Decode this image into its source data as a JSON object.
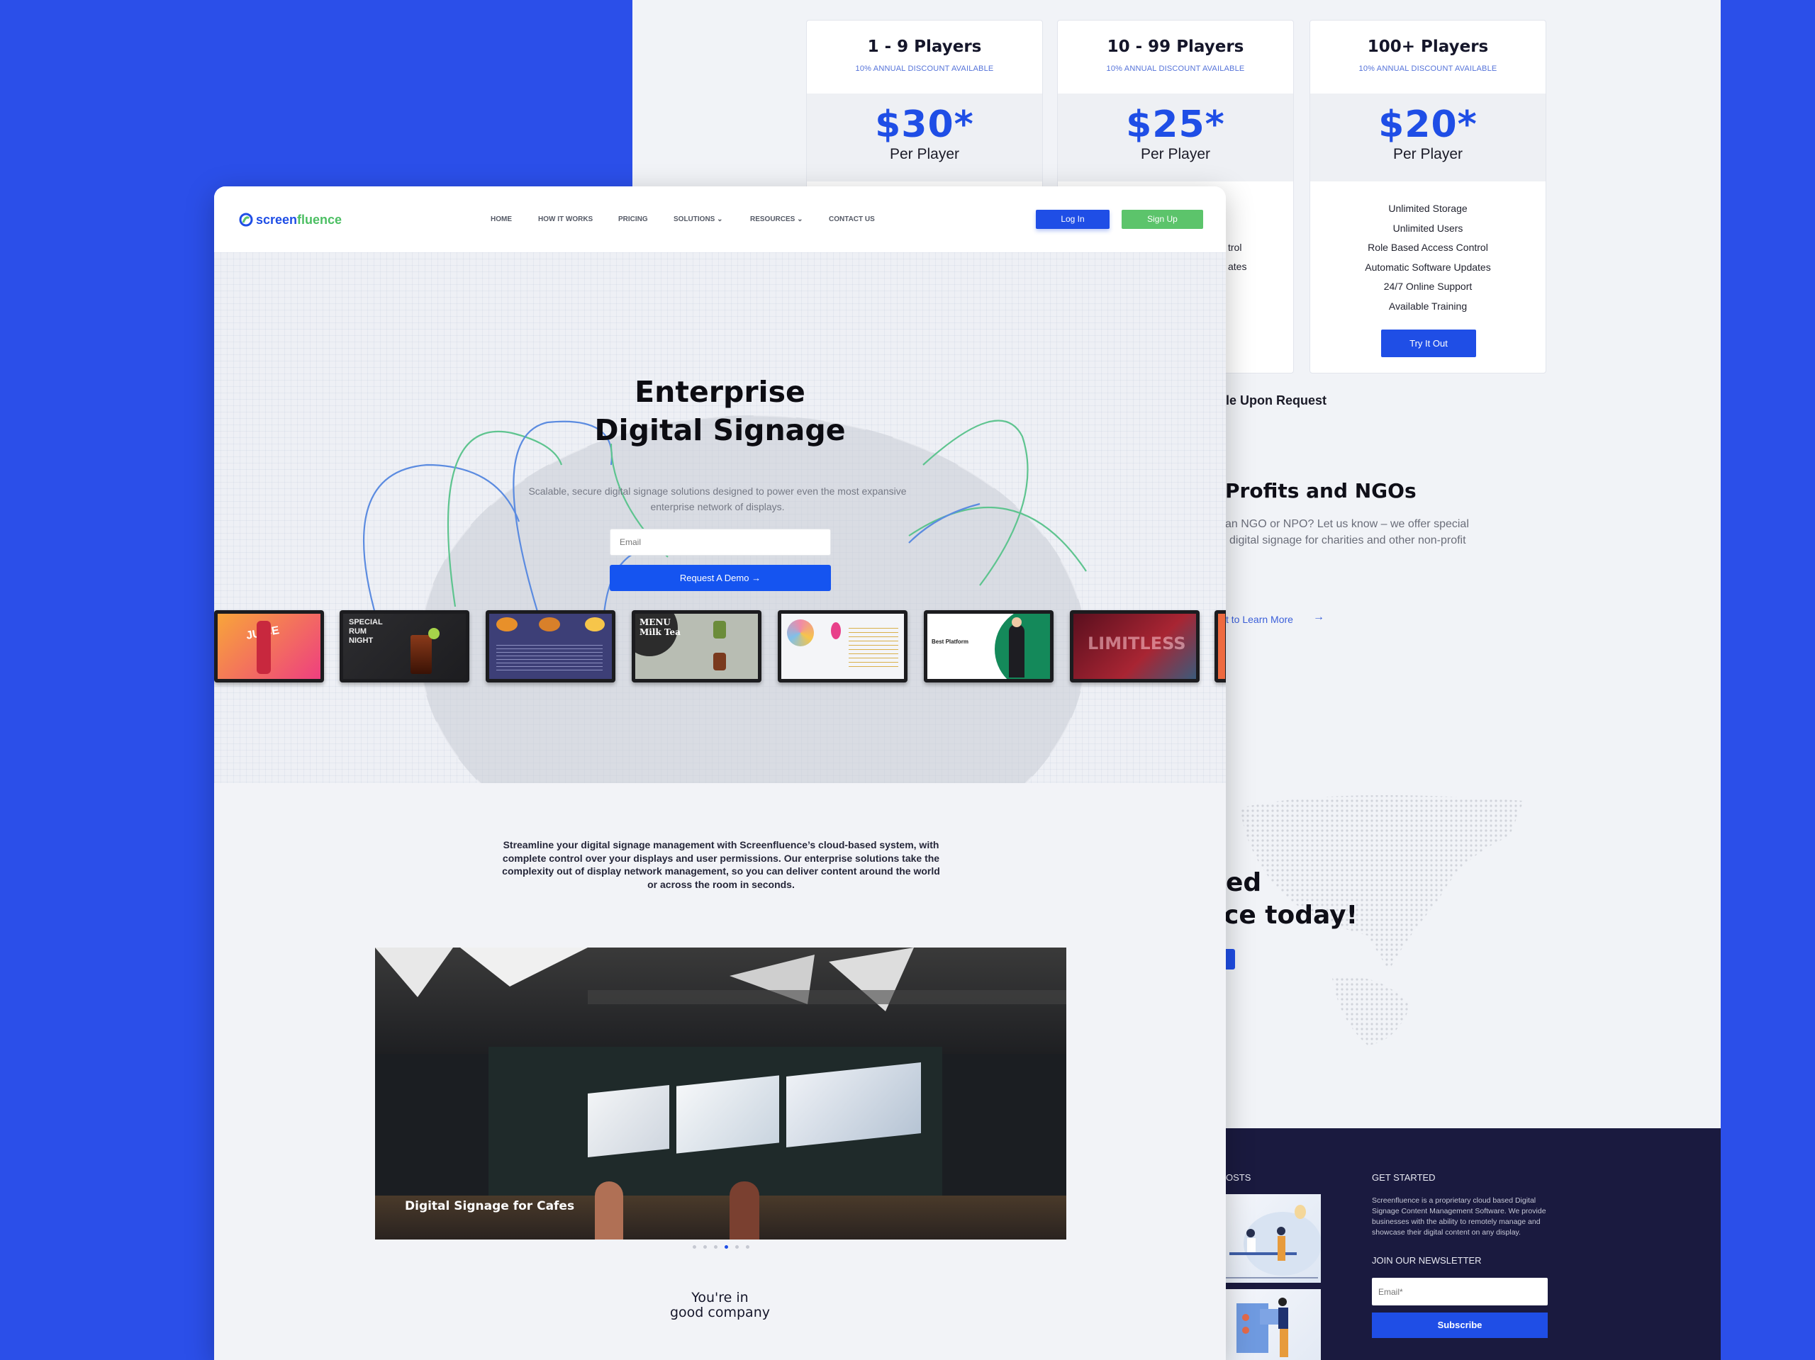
{
  "colors": {
    "brand_blue": "#1f4ee6",
    "brand_green": "#5cc46b",
    "footer_navy": "#1a1a3f",
    "page_bg": "#f1f3f7"
  },
  "pricing": [
    {
      "tier": "1 - 9 Players",
      "discount": "10% ANNUAL DISCOUNT AVAILABLE",
      "price": "$30*",
      "per": "Per Player"
    },
    {
      "tier": "10 - 99 Players",
      "discount": "10% ANNUAL DISCOUNT AVAILABLE",
      "price": "$25*",
      "per": "Per Player",
      "features_visible": [
        "trol",
        "ates"
      ]
    },
    {
      "tier": "100+ Players",
      "discount": "10% ANNUAL DISCOUNT AVAILABLE",
      "price": "$20*",
      "per": "Per Player",
      "features": [
        "Unlimited Storage",
        "Unlimited Users",
        "Role Based Access Control",
        "Automatic Software Updates",
        "24/7 Online Support",
        "Available Training"
      ],
      "cta": "Try It Out"
    }
  ],
  "back_page": {
    "custom_pricing_fragment": "le Upon Request",
    "nonprofit_heading_fragment": "Profits and NGOs",
    "nonprofit_text_fragments": [
      "an NGO or NPO? Let us know – we offer special",
      "digital signage for charities and other non-profit"
    ],
    "learn_more_fragment": "t to Learn More",
    "cta_heading_fragments": [
      "ed",
      "ce today!"
    ],
    "footer": {
      "posts_heading_fragment": "OSTS",
      "get_started_heading": "GET STARTED",
      "description": "Screenfluence is a proprietary cloud based Digital Signage Content Management Software. We provide businesses with the ability to remotely manage and showcase their digital content on any display.",
      "newsletter_heading": "JOIN OUR NEWSLETTER",
      "email_placeholder": "Email*",
      "subscribe_label": "Subscribe"
    }
  },
  "nav": {
    "logo_text_1": "screen",
    "logo_text_2": "fluence",
    "items": [
      "HOME",
      "HOW IT WORKS",
      "PRICING",
      "SOLUTIONS",
      "RESOURCES",
      "CONTACT US"
    ],
    "login": "Log In",
    "signup": "Sign Up"
  },
  "hero": {
    "title_line1": "Enterprise",
    "title_line2": "Digital Signage",
    "subtitle": "Scalable, secure digital signage solutions designed to power even the most expansive enterprise network of displays.",
    "email_placeholder": "Email",
    "cta": "Request A Demo"
  },
  "tiles": [
    {
      "text": "JUICE"
    },
    {
      "text": "SPECIAL\nRUM\nNIGHT"
    },
    {
      "text": ""
    },
    {
      "text": "MENU\nMilk Tea"
    },
    {
      "text": ""
    },
    {
      "text": "Best Platform"
    },
    {
      "text": "LIMITLESS"
    }
  ],
  "intro": "Streamline your digital signage management with Screenfluence’s cloud-based system, with complete control over your displays and user permissions. Our enterprise solutions take the complexity out of display network management, so you can deliver content around the world or across the room in seconds.",
  "carousel": {
    "caption": "Digital Signage for Cafes",
    "slides": 6,
    "active_index": 3
  },
  "company": {
    "line1": "You're in",
    "line2": "good company"
  }
}
